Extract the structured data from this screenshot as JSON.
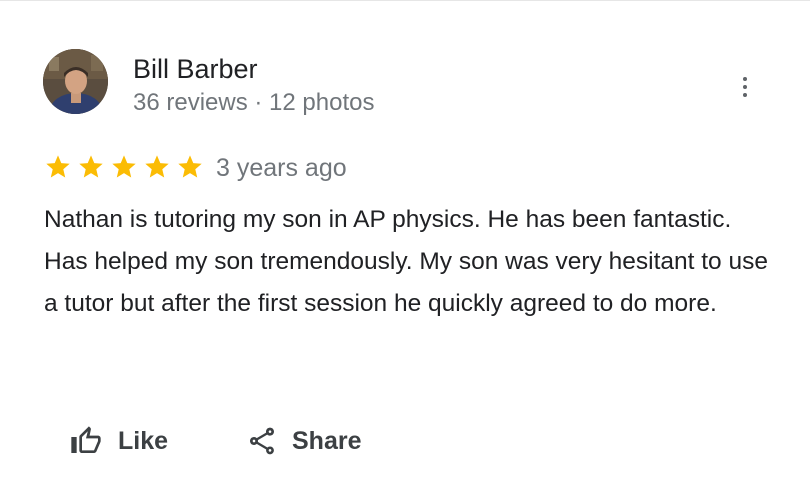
{
  "reviewer": {
    "name": "Bill Barber",
    "stats": "36 reviews · 12 photos"
  },
  "review": {
    "rating": 5,
    "rating_max": 5,
    "time": "3 years ago",
    "text": "Nathan is tutoring my son in AP physics. He has been fantastic.  Has helped my son tremendously. My son was very hesitant to use a tutor but after the first session he quickly agreed to do more."
  },
  "actions": {
    "like_label": "Like",
    "share_label": "Share"
  },
  "icons": {
    "more": "more-vertical-icon",
    "star": "star-icon",
    "like": "thumb-up-icon",
    "share": "share-icon"
  },
  "colors": {
    "star": "#fbbc04",
    "text": "#202124",
    "muted": "#70757a"
  }
}
